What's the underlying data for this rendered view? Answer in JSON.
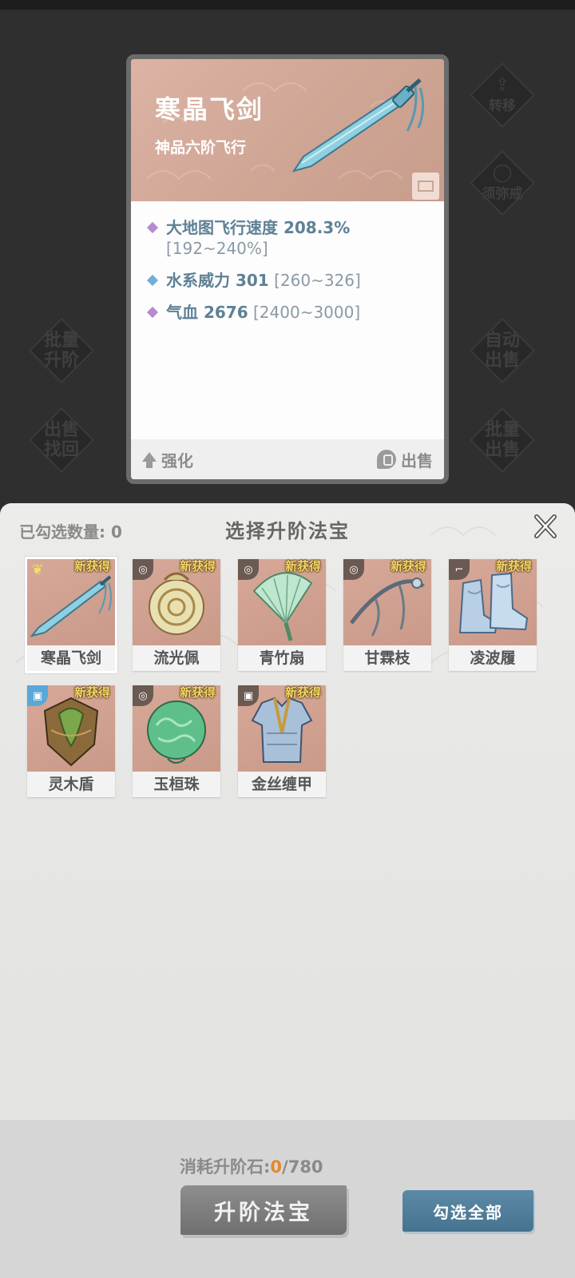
{
  "card": {
    "title": "寒晶飞剑",
    "subtitle": "神品六阶飞行",
    "stats": [
      {
        "name": "大地图飞行速度 208.3%",
        "range": "[192~240%]",
        "gem_color": "#b48ad0"
      },
      {
        "name": "水系威力 301",
        "range": "[260~326]",
        "gem_color": "#6fb0d8"
      },
      {
        "name": "气血 2676",
        "range": "[2400~3000]",
        "gem_color": "#b48ad0"
      }
    ],
    "enhance_label": "强化",
    "sell_label": "出售"
  },
  "side_buttons": {
    "transfer": "转移",
    "ring": "须弥戒",
    "batch_upgrade": "批量升阶",
    "auto_sell": "自动出售",
    "sell_retrieve": "出售找回",
    "batch_sell": "批量出售"
  },
  "panel": {
    "selected_count_label": "已勾选数量: 0",
    "title": "选择升阶法宝",
    "new_badge": "新获得",
    "items": [
      {
        "name": "寒晶飞剑",
        "icon": "wing-icon",
        "selected": true
      },
      {
        "name": "流光佩",
        "icon": "swirl-icon"
      },
      {
        "name": "青竹扇",
        "icon": "swirl-icon"
      },
      {
        "name": "甘霖枝",
        "icon": "swirl-icon"
      },
      {
        "name": "凌波履",
        "icon": "boot-icon"
      },
      {
        "name": "灵木盾",
        "icon": "armor-icon"
      },
      {
        "name": "玉桓珠",
        "icon": "swirl-icon"
      },
      {
        "name": "金丝缠甲",
        "icon": "armor-icon"
      }
    ]
  },
  "footer": {
    "cost_label": "消耗升阶石:",
    "cost_current": "0",
    "cost_total": "/780",
    "upgrade_label": "升阶法宝",
    "select_all_label": "勾选全部"
  }
}
